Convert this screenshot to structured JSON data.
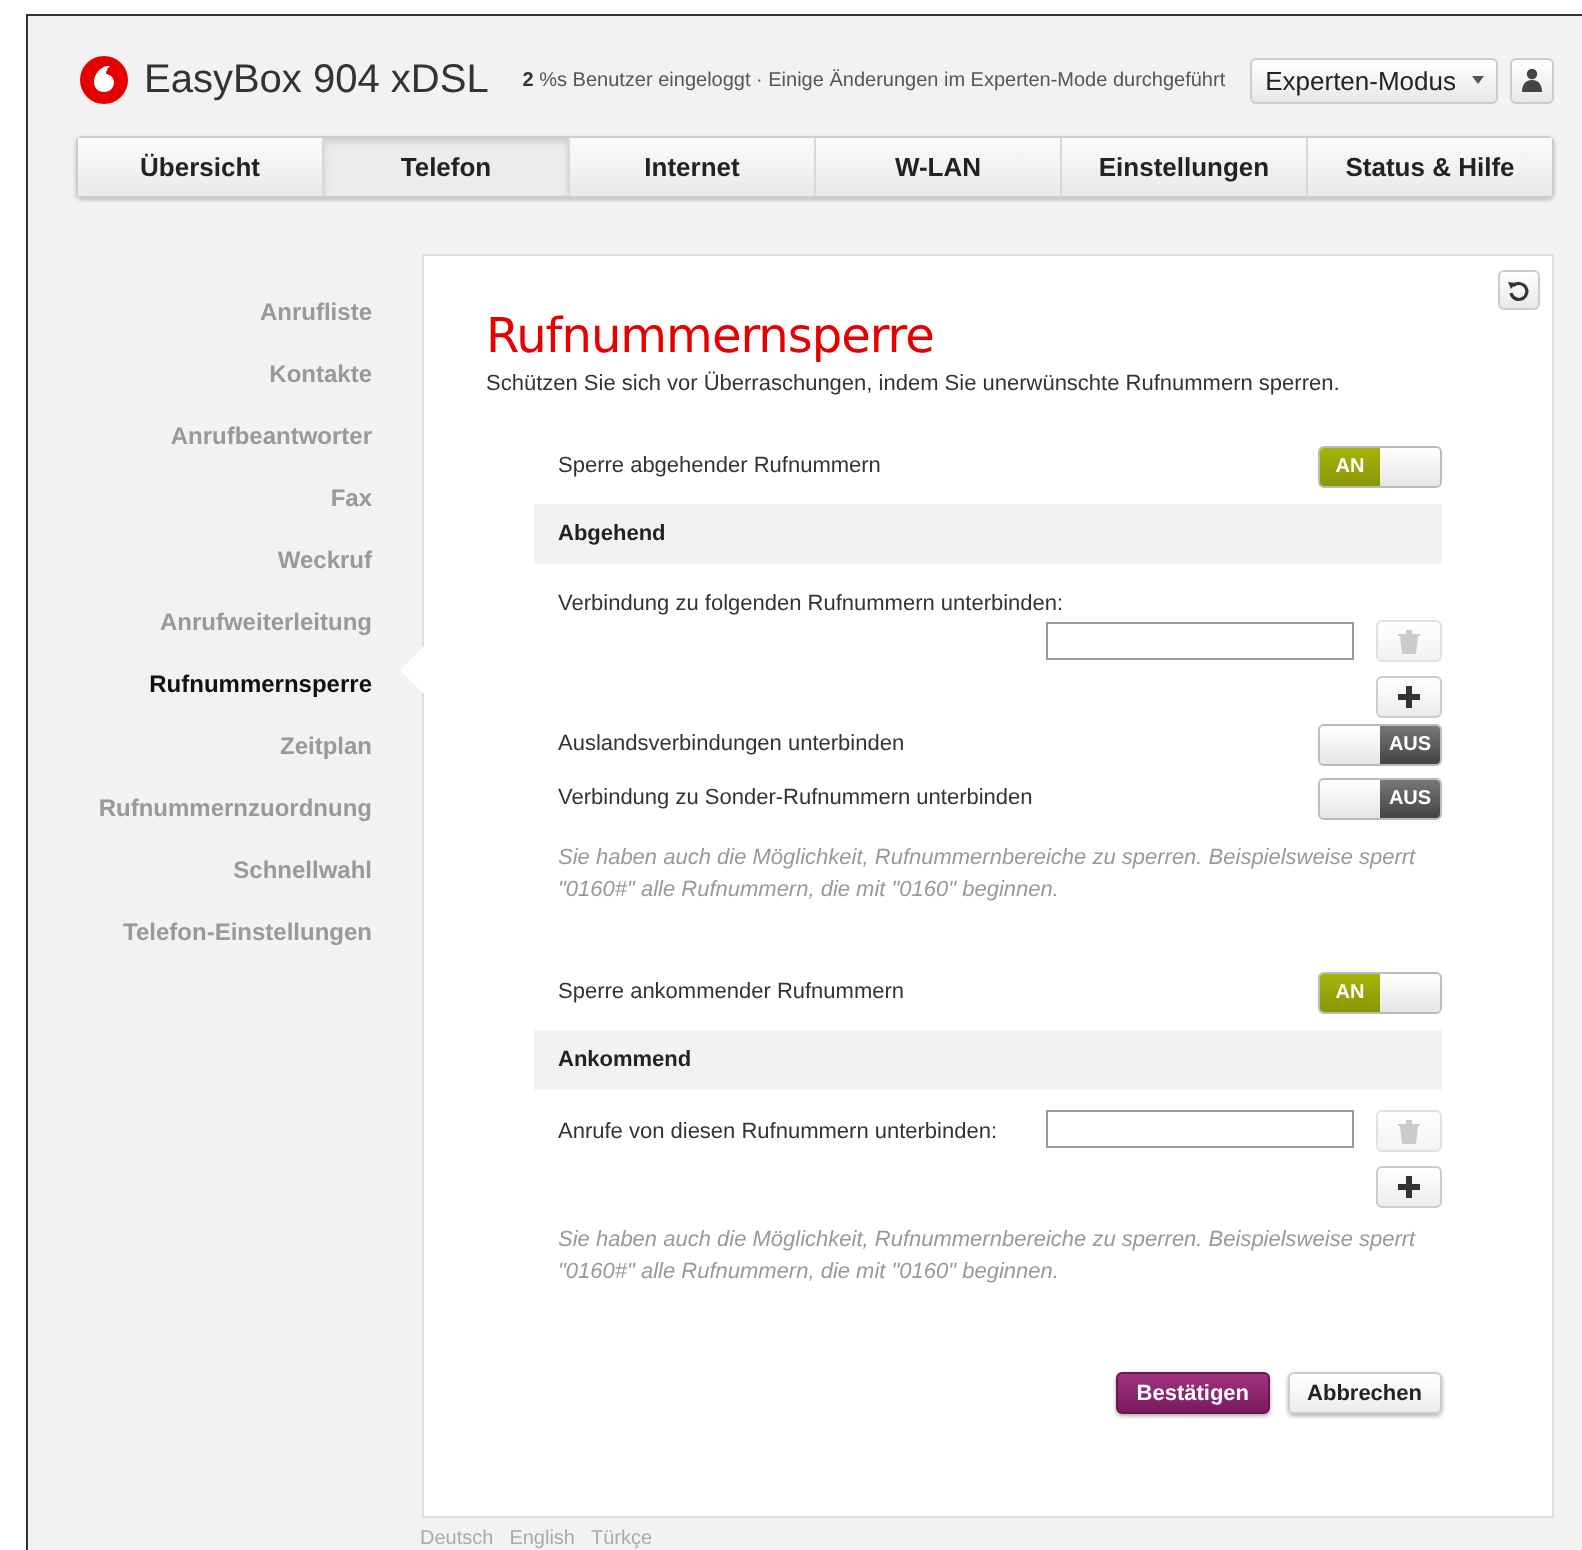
{
  "header": {
    "product": "EasyBox 904 xDSL",
    "status": "**2** %s Benutzer eingeloggt · Einige Änderungen im Experten-Mode durchgeführt",
    "mode": "Experten-Modus"
  },
  "nav": [
    {
      "label": "Übersicht",
      "selected": false
    },
    {
      "label": "Telefon",
      "selected": true
    },
    {
      "label": "Internet",
      "selected": false
    },
    {
      "label": "W-LAN",
      "selected": false
    },
    {
      "label": "Einstellungen",
      "selected": false
    },
    {
      "label": "Status & Hilfe",
      "selected": false
    }
  ],
  "sidebar": [
    {
      "label": "Anrufliste",
      "selected": false
    },
    {
      "label": "Kontakte",
      "selected": false
    },
    {
      "label": "Anrufbeantworter",
      "selected": false
    },
    {
      "label": "Fax",
      "selected": false
    },
    {
      "label": "Weckruf",
      "selected": false
    },
    {
      "label": "Anrufweiterleitung",
      "selected": false
    },
    {
      "label": "Rufnummernsperre",
      "selected": true
    },
    {
      "label": "Zeitplan",
      "selected": false
    },
    {
      "label": "Rufnummernzuordnung",
      "selected": false
    },
    {
      "label": "Schnellwahl",
      "selected": false
    },
    {
      "label": "Telefon-Einstellungen",
      "selected": false
    }
  ],
  "page": {
    "title": "Rufnummernsperre",
    "intro": "Schützen Sie sich vor Überraschungen, indem Sie unerwünschte Rufnummern sperren."
  },
  "sections": [
    {
      "toggle": {
        "label": "Sperre abgehender Rufnummern",
        "on": true,
        "text": "AN"
      },
      "heading": "Abgehend",
      "block_label": "Verbindung zu folgenden Rufnummern unterbinden:",
      "kind": "stacked",
      "options": [
        {
          "label": "Auslandsverbindungen unterbinden",
          "on": false,
          "text": "AUS"
        },
        {
          "label": "Verbindung zu Sonder-Rufnummern unterbinden",
          "on": false,
          "text": "AUS"
        }
      ],
      "hint": "Sie haben auch die Möglichkeit, Rufnummernbereiche zu sperren. Beispielsweise sperrt \"0160#\" alle Rufnummern, die mit \"0160\" beginnen."
    },
    {
      "toggle": {
        "label": "Sperre ankommender Rufnummern",
        "on": true,
        "text": "AN"
      },
      "heading": "Ankommend",
      "block_label": "Anrufe von diesen Rufnummern unterbinden:",
      "kind": "inline",
      "hint": "Sie haben auch die Möglichkeit, Rufnummernbereiche zu sperren. Beispielsweise sperrt \"0160#\" alle Rufnummern, die mit \"0160\" beginnen."
    }
  ],
  "actions": {
    "confirm": "Bestätigen",
    "cancel": "Abbrechen"
  },
  "languages": [
    "Deutsch",
    "English",
    "Türkçe"
  ]
}
